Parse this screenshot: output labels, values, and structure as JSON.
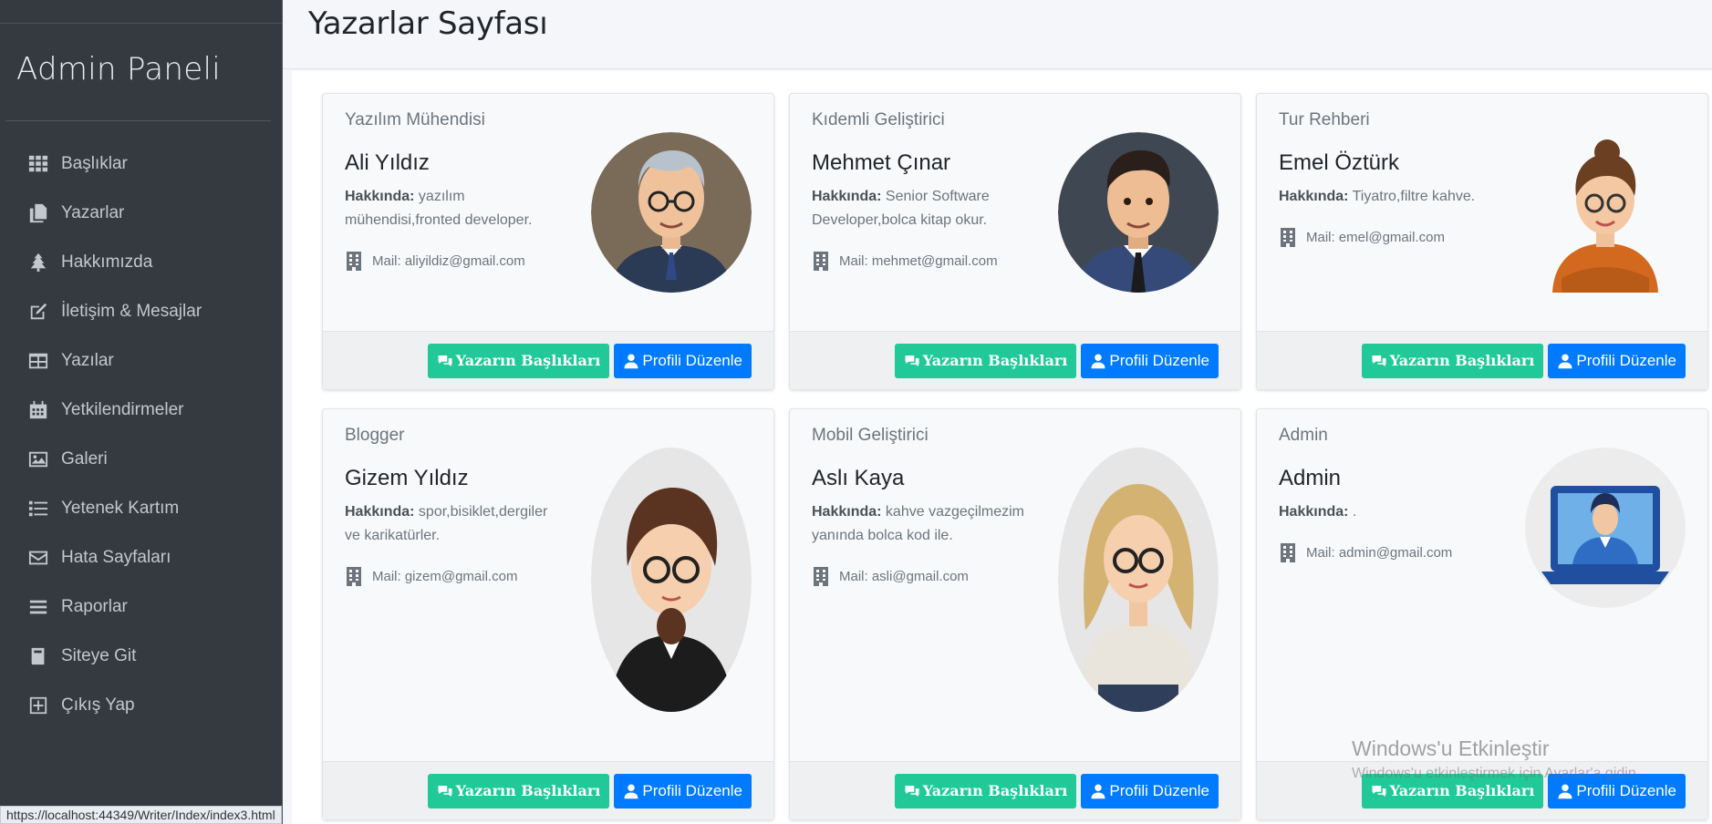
{
  "sidebar": {
    "brand": "Admin Paneli",
    "items": [
      {
        "label": "Başlıklar",
        "icon": "grid-icon"
      },
      {
        "label": "Yazarlar",
        "icon": "copy-icon"
      },
      {
        "label": "Hakkımızda",
        "icon": "tree-icon"
      },
      {
        "label": "İletişim & Mesajlar",
        "icon": "edit-icon"
      },
      {
        "label": "Yazılar",
        "icon": "table-icon"
      },
      {
        "label": "Yetkilendirmeler",
        "icon": "calendar-icon"
      },
      {
        "label": "Galeri",
        "icon": "image-icon"
      },
      {
        "label": "Yetenek Kartım",
        "icon": "list-icon"
      },
      {
        "label": "Hata Sayfaları",
        "icon": "envelope-icon"
      },
      {
        "label": "Raporlar",
        "icon": "bars-icon"
      },
      {
        "label": "Siteye Git",
        "icon": "book-icon"
      },
      {
        "label": "Çıkış Yap",
        "icon": "plus-square-icon"
      }
    ]
  },
  "page": {
    "title": "Yazarlar Sayfası"
  },
  "labels": {
    "about": "Hakkında:",
    "mail_prefix": "Mail:",
    "btn_titles": "Yazarın Başlıkları",
    "btn_edit": "Profili Düzenle"
  },
  "writers": [
    {
      "role": "Yazılım Mühendisi",
      "name": "Ali Yıldız",
      "about": "yazılım mühendisi,fronted developer.",
      "mail": "aliyildiz@gmail.com"
    },
    {
      "role": "Kıdemli Geliştirici",
      "name": "Mehmet Çınar",
      "about": "Senior Software Developer,bolca kitap okur.",
      "mail": "mehmet@gmail.com"
    },
    {
      "role": "Tur Rehberi",
      "name": "Emel Öztürk",
      "about": "Tiyatro,filtre kahve.",
      "mail": "emel@gmail.com"
    },
    {
      "role": "Blogger",
      "name": "Gizem Yıldız",
      "about": "spor,bisiklet,dergiler ve karikatürler.",
      "mail": "gizem@gmail.com"
    },
    {
      "role": "Mobil Geliştirici",
      "name": "Aslı Kaya",
      "about": "kahve vazgeçilmezim yanında bolca kod ile.",
      "mail": "asli@gmail.com"
    },
    {
      "role": "Admin",
      "name": "Admin",
      "about": ".",
      "mail": "admin@gmail.com"
    }
  ],
  "status_bar": {
    "url": "https://localhost:44349/Writer/Index/index3.html"
  },
  "watermark": {
    "line1": "Windows'u Etkinleştir",
    "line2": "Windows'u etkinleştirmek için Ayarlar'a gidin."
  },
  "colors": {
    "sidebar": "#343a40",
    "success": "#20c997",
    "primary": "#007bff"
  }
}
